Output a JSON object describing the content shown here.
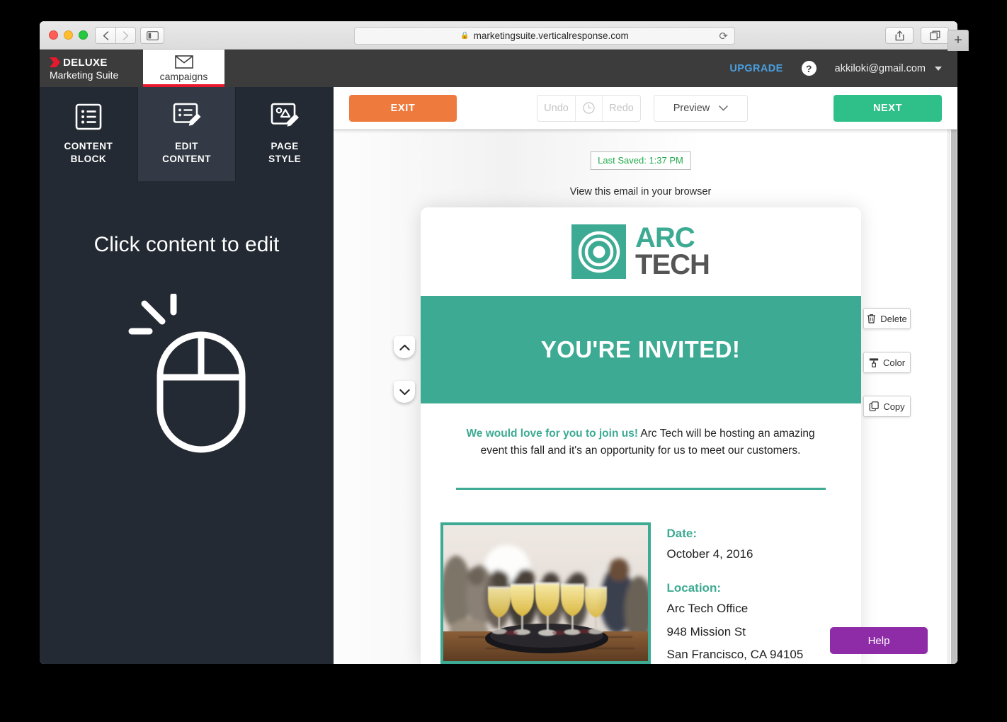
{
  "browser": {
    "url": "marketingsuite.verticalresponse.com",
    "lock_icon": "lock-icon",
    "reload_icon": "reload-icon",
    "back_icon": "chevron-left-icon",
    "forward_icon": "chevron-right-icon",
    "sidebar_icon": "sidebar-toggle-icon",
    "share_icon": "share-icon",
    "tabs_icon": "show-tabs-icon",
    "new_tab_label": "+"
  },
  "app_header": {
    "brand_name": "DELUXE",
    "brand_sub": "Marketing Suite",
    "tab_label": "campaigns",
    "tab_icon": "envelope-icon",
    "upgrade_label": "UPGRADE",
    "help_label": "?",
    "account_email": "akkiloki@gmail.com"
  },
  "left_panel": {
    "mode_tabs": [
      {
        "label": "CONTENT\nBLOCK",
        "line1": "CONTENT",
        "line2": "BLOCK",
        "icon": "list-block-icon",
        "active": false
      },
      {
        "label": "EDIT\nCONTENT",
        "line1": "EDIT",
        "line2": "CONTENT",
        "icon": "edit-content-icon",
        "active": true
      },
      {
        "label": "PAGE\nSTYLE",
        "line1": "PAGE",
        "line2": "STYLE",
        "icon": "page-style-icon",
        "active": false
      }
    ],
    "panel_title": "Click content to edit",
    "panel_icon": "mouse-click-icon"
  },
  "toolbar": {
    "exit_label": "EXIT",
    "undo_label": "Undo",
    "history_icon": "clock-icon",
    "redo_label": "Redo",
    "preview_label": "Preview",
    "preview_caret": "chevron-down-icon",
    "next_label": "NEXT"
  },
  "canvas": {
    "saved_status": "Last Saved: 1:37 PM",
    "view_in_browser": "View this email in your browser",
    "move_up_icon": "chevron-up-icon",
    "move_down_icon": "chevron-down-icon",
    "side_actions": [
      {
        "label": "Delete",
        "icon": "trash-icon"
      },
      {
        "label": "Color",
        "icon": "paint-roller-icon"
      },
      {
        "label": "Copy",
        "icon": "copy-icon"
      }
    ],
    "help_label": "Help"
  },
  "email": {
    "logo": {
      "name_part1": "ARC",
      "name_part2": "TECH",
      "icon": "bullseye-icon"
    },
    "hero_title": "YOU'RE INVITED!",
    "intro_lead": "We would love for you to join us!",
    "intro_rest": " Arc Tech will be hosting an amazing event this fall and it's an opportunity for us to meet our customers.",
    "photo_alt": "champagne-glasses-event-photo",
    "date_label": "Date:",
    "date_value": "October 4, 2016",
    "location_label": "Location:",
    "location_line1": "Arc Tech Office",
    "location_line2": "948 Mission St",
    "location_line3": "San Francisco, CA 94105"
  },
  "colors": {
    "brand_red": "#e8192c",
    "teal": "#3daa93",
    "orange": "#ef7a3d",
    "green": "#2fc08a",
    "purple": "#8e2ca8",
    "upgrade_blue": "#4a9fe0",
    "saved_green": "#22a94a",
    "panel_dark": "#242a33"
  }
}
